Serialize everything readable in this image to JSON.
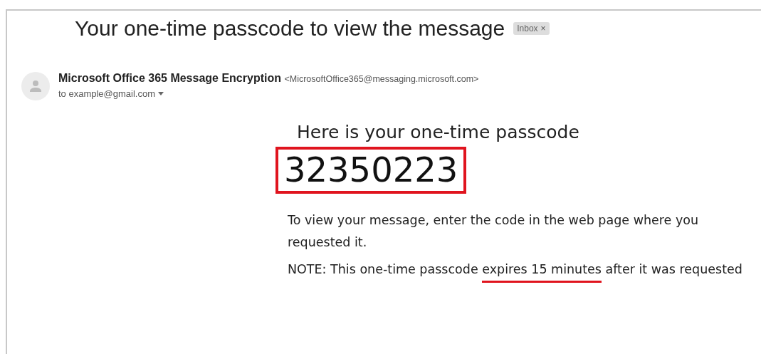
{
  "email": {
    "subject": "Your one-time passcode to view the message",
    "labels": [
      {
        "text": "Inbox",
        "remove": "×"
      }
    ],
    "sender": {
      "name": "Microsoft Office 365 Message Encryption",
      "address": "<MicrosoftOffice365@messaging.microsoft.com>",
      "recipient": "to example@gmail.com"
    },
    "body": {
      "heading": "Here is your one-time passcode",
      "passcode": "32350223",
      "passcode_highlighted": true,
      "instruction": "To view your message, enter the code in the web page where you requested it.",
      "note": [
        {
          "text": "NOTE: This one-time passcode ",
          "underlined": false
        },
        {
          "text": "expires 15 minutes",
          "underlined": true
        },
        {
          "text": " after it was requested",
          "underlined": false
        }
      ]
    }
  }
}
